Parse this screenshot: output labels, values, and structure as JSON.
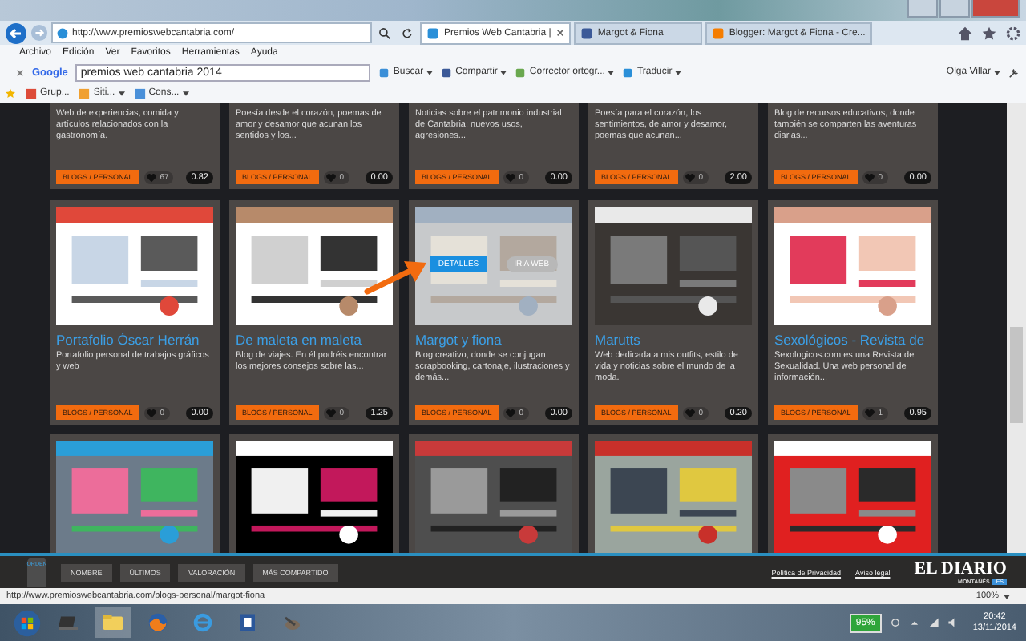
{
  "address_bar": {
    "url": "http://www.premioswebcantabria.com/"
  },
  "tabs": [
    {
      "label": "Premios Web Cantabria |",
      "selected": true,
      "kind": "site"
    },
    {
      "label": "Margot & Fiona",
      "selected": false,
      "kind": "facebook"
    },
    {
      "label": "Blogger: Margot & Fiona - Cre...",
      "selected": false,
      "kind": "blogger"
    }
  ],
  "menu": [
    "Archivo",
    "Edición",
    "Ver",
    "Favoritos",
    "Herramientas",
    "Ayuda"
  ],
  "google_toolbar": {
    "brand": "Google",
    "search_value": "premios web cantabria 2014",
    "buttons": [
      "Buscar",
      "Compartir",
      "Corrector ortogr...",
      "Traducir"
    ],
    "user": "Olga Villar"
  },
  "favorites": [
    "Grup...",
    "Siti...",
    "Cons..."
  ],
  "card_rows": [
    {
      "cards": [
        {
          "description": "Web de experiencias, comida y artículos relacionados con la gastronomía.",
          "category": "BLOGS / PERSONAL",
          "likes": "67",
          "score": "0.82"
        },
        {
          "description": "Poesía desde el corazón, poemas de amor y desamor que acunan los sentidos y los...",
          "category": "BLOGS / PERSONAL",
          "likes": "0",
          "score": "0.00"
        },
        {
          "description": "Noticias sobre el patrimonio industrial de Cantabria: nuevos usos, agresiones...",
          "category": "BLOGS / PERSONAL",
          "likes": "0",
          "score": "0.00"
        },
        {
          "description": "Poesía para el corazón, los sentimientos, de amor y desamor, poemas que acunan...",
          "category": "BLOGS / PERSONAL",
          "likes": "0",
          "score": "2.00"
        },
        {
          "description": "Blog de recursos educativos, donde también se comparten las aventuras diarias...",
          "category": "BLOGS / PERSONAL",
          "likes": "0",
          "score": "0.00"
        }
      ]
    },
    {
      "cards": [
        {
          "kind": "picture",
          "title": "Portafolio Óscar Herrán",
          "description": "Portafolio personal de trabajos gráficos y web",
          "category": "BLOGS / PERSONAL",
          "likes": "0",
          "score": "0.00",
          "hovered": false
        },
        {
          "kind": "picture",
          "title": "De maleta en maleta",
          "description": "Blog de viajes. En él podréis encontrar los mejores consejos sobre las...",
          "category": "BLOGS / PERSONAL",
          "likes": "0",
          "score": "1.25",
          "hovered": false
        },
        {
          "kind": "picture",
          "title": "Margot y fiona",
          "description": "Blog creativo, donde se conjugan scrapbooking, cartonaje, ilustraciones y demás...",
          "category": "BLOGS / PERSONAL",
          "likes": "0",
          "score": "0.00",
          "hovered": true,
          "overlay_buttons": [
            "DETALLES",
            "IR A WEB"
          ]
        },
        {
          "kind": "picture",
          "title": "Marutts",
          "description": "Web dedicada a mis outfits, estilo de vida y noticias sobre el mundo de la moda.",
          "category": "BLOGS / PERSONAL",
          "likes": "0",
          "score": "0.20",
          "hovered": false
        },
        {
          "kind": "picture",
          "title": "Sexológicos - Revista de",
          "description": "Sexologicos.com es una Revista de Sexualidad. Una web personal de información...",
          "category": "BLOGS / PERSONAL",
          "likes": "1",
          "score": "0.95",
          "hovered": false
        }
      ]
    },
    {
      "cards": [
        {
          "kind": "picture",
          "hovered": false
        },
        {
          "kind": "picture",
          "hovered": false
        },
        {
          "kind": "picture",
          "hovered": false
        },
        {
          "kind": "picture",
          "hovered": false
        },
        {
          "kind": "picture",
          "hovered": false
        }
      ]
    }
  ],
  "sort_bar": {
    "label": "ORDEN",
    "buttons": [
      "NOMBRE",
      "ÚLTIMOS",
      "VALORACIÓN",
      "MÁS COMPARTIDO"
    ],
    "links": [
      "Política de Privacidad",
      "Aviso legal"
    ],
    "logo": "EL DIARIO",
    "logo_sub": "MONTAÑÉS",
    "logo_badge": "ES"
  },
  "status_bar": {
    "url": "http://www.premioswebcantabria.com/blogs-personal/margot-fiona",
    "zoom": "100%"
  },
  "taskbar": {
    "battery": "95%",
    "time": "20:42",
    "date": "13/11/2014"
  }
}
